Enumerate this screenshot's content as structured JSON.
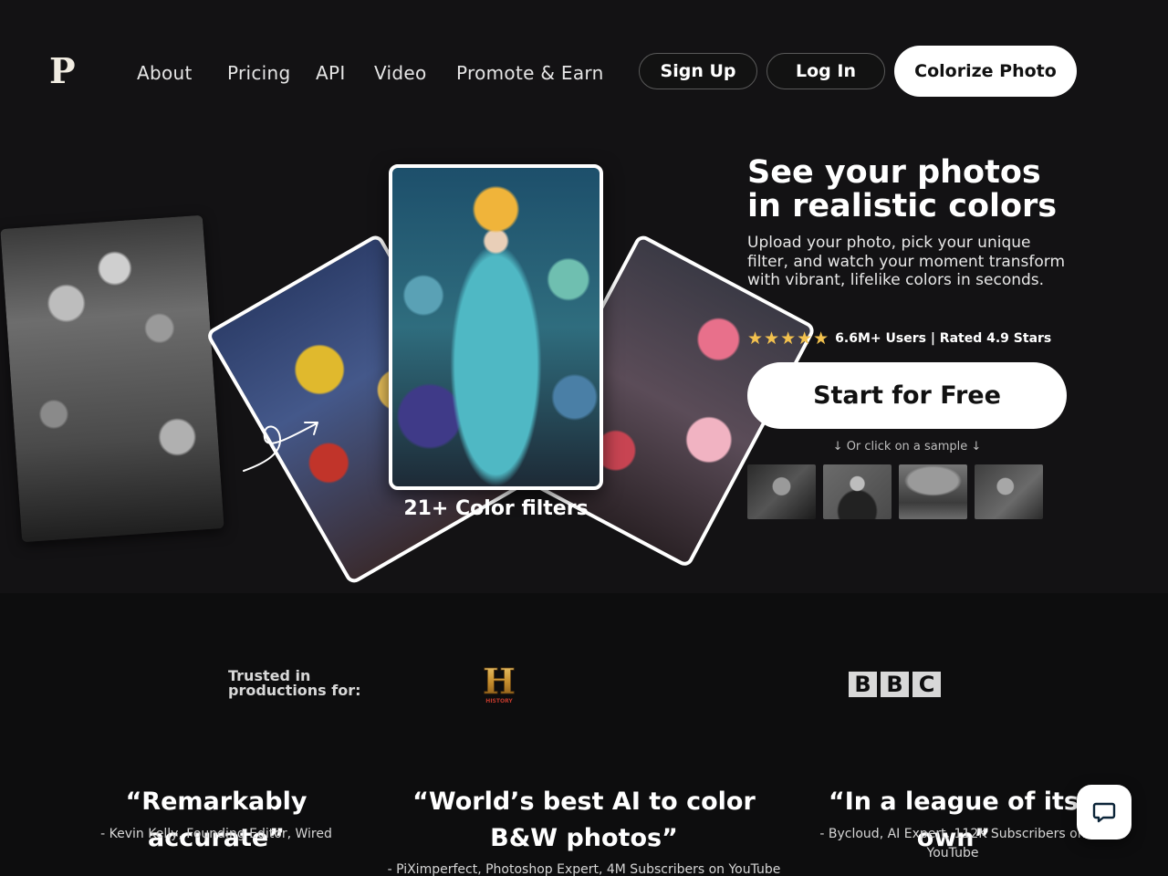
{
  "nav": {
    "logo": "P",
    "links": [
      "About",
      "Pricing",
      "API",
      "Video",
      "Promote & Earn"
    ],
    "signup_label": "Sign Up",
    "login_label": "Log In",
    "colorize_label": "Colorize Photo"
  },
  "hero": {
    "filters_label": "21+ Color filters",
    "title_line1": "See your photos",
    "title_line2": "in realistic colors",
    "subtitle": "Upload your photo, pick your unique filter, and watch your moment transform with vibrant, lifelike colors in seconds.",
    "stars": "★★★★★",
    "rating_text": "6.6M+ Users | Rated 4.9 Stars",
    "cta_label": "Start for Free",
    "sample_hint": "↓ Or click on a sample ↓"
  },
  "trusted": {
    "label_line1": "Trusted in",
    "label_line2": "productions for:",
    "history_letter": "H",
    "history_word": "HISTORY",
    "bbc_letters": [
      "B",
      "B",
      "C"
    ]
  },
  "quotes": [
    {
      "text": "“Remarkably accurate”",
      "attribution": "- Kevin Kelly, Founding Editor, Wired"
    },
    {
      "text": "“World’s best AI to color B&W photos”",
      "attribution": "- PiXimperfect, Photoshop Expert, 4M Subscribers on YouTube"
    },
    {
      "text": "“In a league of its own”",
      "attribution": "- Bycloud, AI Expert, 112K Subscribers on YouTube"
    }
  ],
  "colors": {
    "background": "#131214",
    "accent_star": "#f2c14e",
    "button_light": "#ffffff"
  }
}
